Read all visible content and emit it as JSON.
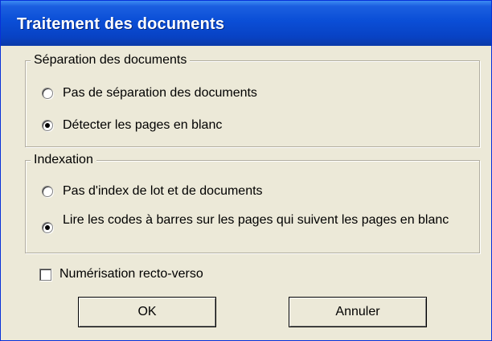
{
  "window": {
    "title": "Traitement des documents"
  },
  "separation": {
    "legend": "Séparation des documents",
    "options": [
      {
        "label": "Pas de séparation des documents",
        "selected": false
      },
      {
        "label": "Détecter les pages en blanc",
        "selected": true
      }
    ]
  },
  "indexation": {
    "legend": "Indexation",
    "options": [
      {
        "label": "Pas d'index de lot et de documents",
        "selected": false
      },
      {
        "label": "Lire les codes à barres sur les pages qui suivent les pages en blanc",
        "selected": true
      }
    ]
  },
  "duplex": {
    "label": "Numérisation recto-verso",
    "checked": false
  },
  "buttons": {
    "ok": "OK",
    "cancel": "Annuler"
  }
}
